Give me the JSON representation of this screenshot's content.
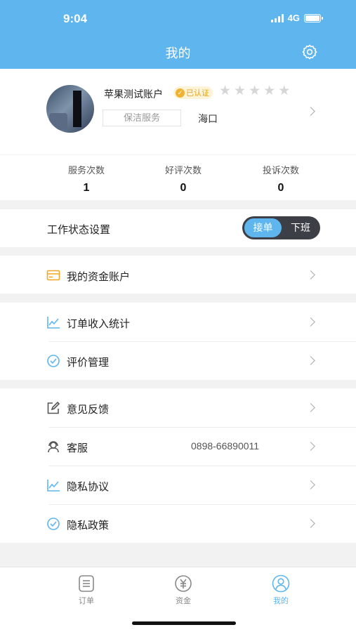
{
  "status_bar": {
    "time": "9:04",
    "network": "4G"
  },
  "header": {
    "title": "我的"
  },
  "profile": {
    "name": "苹果测试账户",
    "certified_label": "已认证",
    "service_tag": "保洁服务",
    "city": "海口",
    "rating_stars": 0,
    "rating_max": 5
  },
  "stats": [
    {
      "label": "服务次数",
      "value": "1"
    },
    {
      "label": "好评次数",
      "value": "0"
    },
    {
      "label": "投诉次数",
      "value": "0"
    }
  ],
  "work_status": {
    "label": "工作状态设置",
    "on_label": "接单",
    "off_label": "下班",
    "selected": "接单"
  },
  "menu": {
    "account": {
      "label": "我的资金账户"
    },
    "income": {
      "label": "订单收入统计"
    },
    "reviews": {
      "label": "评价管理"
    },
    "feedback": {
      "label": "意见反馈"
    },
    "service": {
      "label": "客服",
      "value": "0898-66890011"
    },
    "privacy_agreement": {
      "label": "隐私协议"
    },
    "privacy_policy": {
      "label": "隐私政策"
    }
  },
  "tabs": [
    {
      "label": "订单",
      "icon": "order-list-icon"
    },
    {
      "label": "资金",
      "icon": "yuan-icon"
    },
    {
      "label": "我的",
      "icon": "user-icon",
      "active": true
    }
  ],
  "colors": {
    "accent": "#5fb5ee",
    "toggle_bg": "#3c4046",
    "cert": "#f0b232",
    "account_icon": "#f5a623"
  }
}
